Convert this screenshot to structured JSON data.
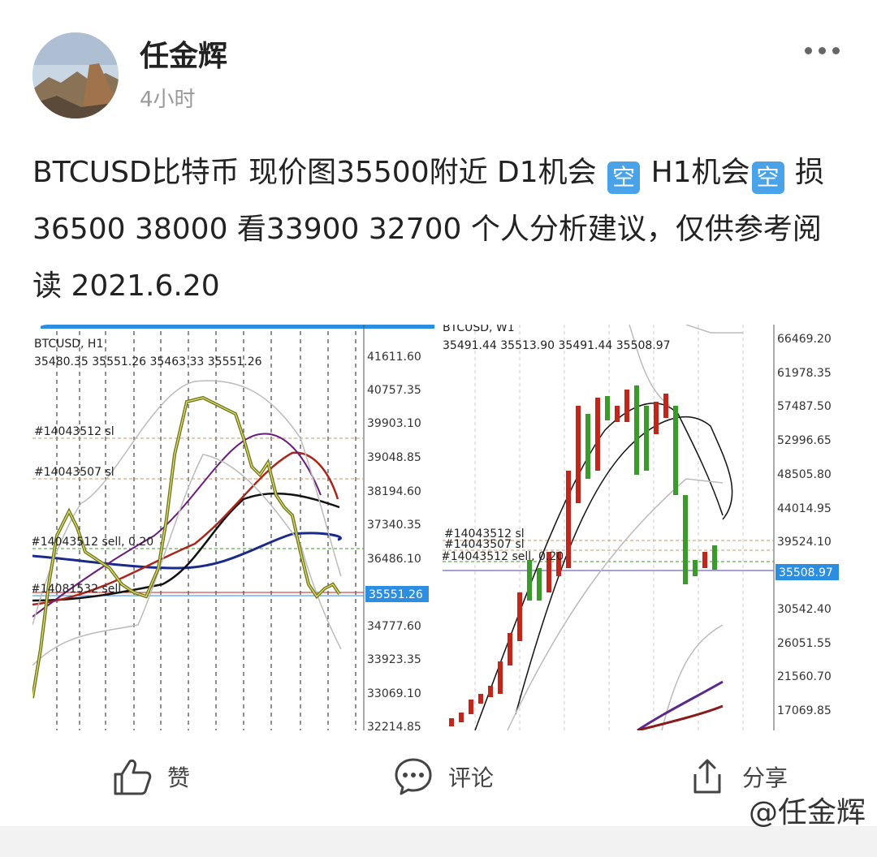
{
  "post": {
    "author": "任金辉",
    "time": "4小时",
    "text_parts": {
      "p1": "BTCUSD比特币 现价图35500附近 D1机会",
      "tag1": "空",
      "p2": " H1机会",
      "tag2": "空",
      "p3": "损36500 38000 看33900 32700 个人分析建议，仅供参考阅读 2021.6.20"
    }
  },
  "chart_left": {
    "symbol": "BTCUSD, H1",
    "ohlc": "35480.35 35551.26 35463.33 35551.26",
    "orders": [
      "#14043512 sl",
      "#14043507 sl",
      "#14043512 sell, 0.20",
      "#14081532 sell"
    ],
    "price_levels": [
      "41611.60",
      "40757.35",
      "39903.10",
      "39048.85",
      "38194.60",
      "37340.35",
      "36486.10",
      "34777.60",
      "33923.35",
      "33069.10",
      "32214.85"
    ],
    "current_price": "35551.26",
    "colors": {
      "up": "#3a9a2a",
      "down": "#c0261a",
      "current": "#2b8ee0"
    }
  },
  "chart_right": {
    "symbol": "BTCUSD, W1",
    "ohlc": "35491.44 35513.90 35491.44 35508.97",
    "orders": [
      "#14043512 sl",
      "#14043507 sl",
      "#14043512 sell, 0.20"
    ],
    "price_levels": [
      "66469.20",
      "61978.35",
      "57487.50",
      "52996.65",
      "48505.80",
      "44014.95",
      "39524.10",
      "30542.40",
      "26051.55",
      "21560.70",
      "17069.85"
    ],
    "current_price": "35508.97"
  },
  "actions": {
    "like": "赞",
    "comment": "评论",
    "share": "分享"
  },
  "watermark": "@任金辉"
}
